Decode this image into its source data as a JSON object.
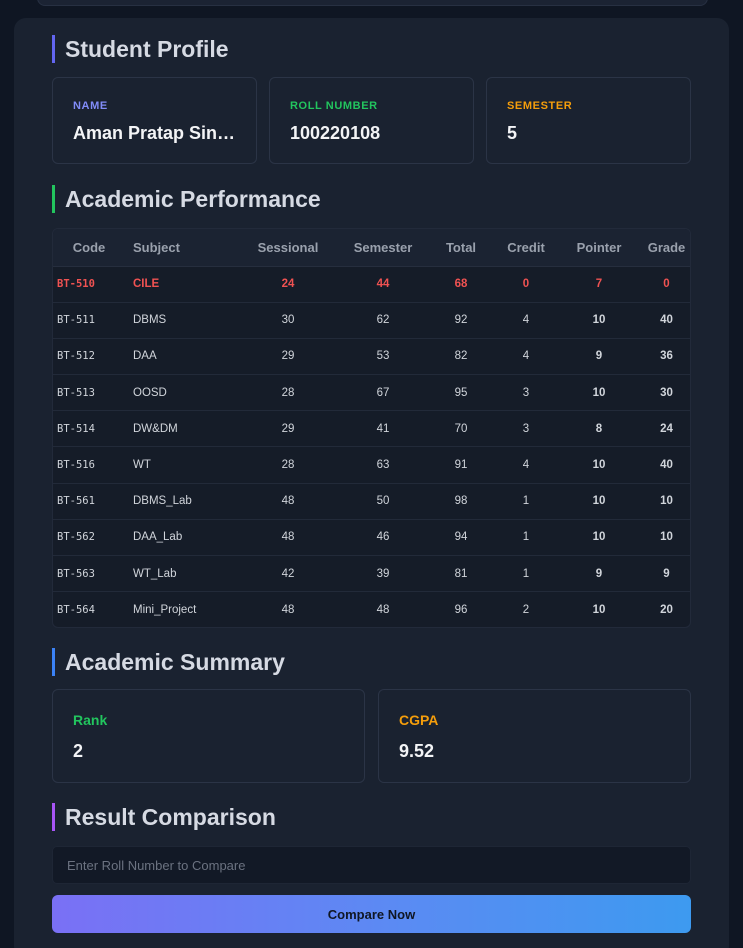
{
  "profile": {
    "title": "Student Profile",
    "name_label": "NAME",
    "name_value": "Aman Pratap Sin…",
    "roll_label": "ROLL NUMBER",
    "roll_value": "100220108",
    "semester_label": "SEMESTER",
    "semester_value": "5"
  },
  "performance": {
    "title": "Academic Performance",
    "headers": [
      "Code",
      "Subject",
      "Sessional",
      "Semester",
      "Total",
      "Credit",
      "Pointer",
      "Grade"
    ],
    "rows": [
      {
        "code": "BT-510",
        "subject": "CILE",
        "sessional": "24",
        "semester": "44",
        "total": "68",
        "credit": "0",
        "pointer": "7",
        "grade": "0",
        "failed": true
      },
      {
        "code": "BT-511",
        "subject": "DBMS",
        "sessional": "30",
        "semester": "62",
        "total": "92",
        "credit": "4",
        "pointer": "10",
        "grade": "40"
      },
      {
        "code": "BT-512",
        "subject": "DAA",
        "sessional": "29",
        "semester": "53",
        "total": "82",
        "credit": "4",
        "pointer": "9",
        "grade": "36"
      },
      {
        "code": "BT-513",
        "subject": "OOSD",
        "sessional": "28",
        "semester": "67",
        "total": "95",
        "credit": "3",
        "pointer": "10",
        "grade": "30"
      },
      {
        "code": "BT-514",
        "subject": "DW&DM",
        "sessional": "29",
        "semester": "41",
        "total": "70",
        "credit": "3",
        "pointer": "8",
        "grade": "24"
      },
      {
        "code": "BT-516",
        "subject": "WT",
        "sessional": "28",
        "semester": "63",
        "total": "91",
        "credit": "4",
        "pointer": "10",
        "grade": "40"
      },
      {
        "code": "BT-561",
        "subject": "DBMS_Lab",
        "sessional": "48",
        "semester": "50",
        "total": "98",
        "credit": "1",
        "pointer": "10",
        "grade": "10"
      },
      {
        "code": "BT-562",
        "subject": "DAA_Lab",
        "sessional": "48",
        "semester": "46",
        "total": "94",
        "credit": "1",
        "pointer": "10",
        "grade": "10"
      },
      {
        "code": "BT-563",
        "subject": "WT_Lab",
        "sessional": "42",
        "semester": "39",
        "total": "81",
        "credit": "1",
        "pointer": "9",
        "grade": "9"
      },
      {
        "code": "BT-564",
        "subject": "Mini_Project",
        "sessional": "48",
        "semester": "48",
        "total": "96",
        "credit": "2",
        "pointer": "10",
        "grade": "20"
      }
    ]
  },
  "summary": {
    "title": "Academic Summary",
    "rank_label": "Rank",
    "rank_value": "2",
    "cgpa_label": "CGPA",
    "cgpa_value": "9.52"
  },
  "comparison": {
    "title": "Result Comparison",
    "input_placeholder": "Enter Roll Number to Compare",
    "button_label": "Compare Now"
  },
  "colors": {
    "accent_indigo": "#6366f1",
    "accent_green": "#22c55e",
    "accent_amber": "#f59e0b",
    "accent_blue": "#3b82f6",
    "accent_purple": "#a855f7",
    "fail_red": "#f05252"
  }
}
